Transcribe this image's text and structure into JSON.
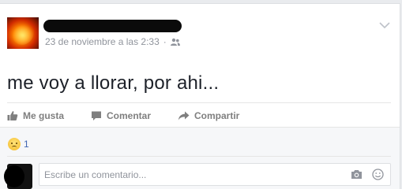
{
  "post": {
    "timestamp": "23 de noviembre a las 2:33",
    "separator": "·",
    "text": "me voy a llorar, por ahi...",
    "audience_icon": "friends-icon",
    "menu_icon": "chevron-down-icon"
  },
  "actions": {
    "like_label": "Me gusta",
    "comment_label": "Comentar",
    "share_label": "Compartir"
  },
  "reactions": {
    "emoji": "sad",
    "count": "1"
  },
  "composer": {
    "placeholder": "Escribe un comentario...",
    "camera_icon": "camera-icon",
    "emoji_icon": "smiley-icon"
  },
  "colors": {
    "link_blue": "#4267b2",
    "muted_gray": "#90949c",
    "action_gray": "#7f7f7f"
  }
}
